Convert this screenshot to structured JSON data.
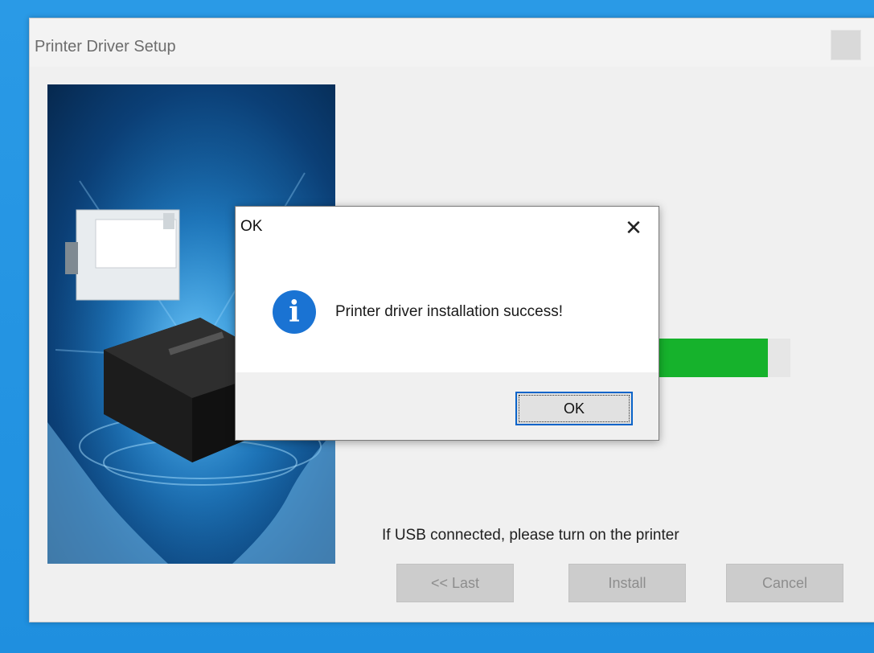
{
  "window": {
    "title": "Printer Driver Setup"
  },
  "progress": {
    "fraction": 0.85,
    "color": "#16b22c"
  },
  "setup": {
    "usb_note": "If USB connected, please turn on the printer",
    "buttons": {
      "last": "<< Last",
      "install": "Install",
      "cancel": "Cancel"
    }
  },
  "dialog": {
    "title": "OK",
    "close_icon": "close-icon",
    "icon": "info-icon",
    "icon_glyph": "i",
    "message": "Printer driver installation success!",
    "ok_label": "OK"
  },
  "colors": {
    "accent": "#1a73d3",
    "desktop": "#1e8fe0"
  }
}
